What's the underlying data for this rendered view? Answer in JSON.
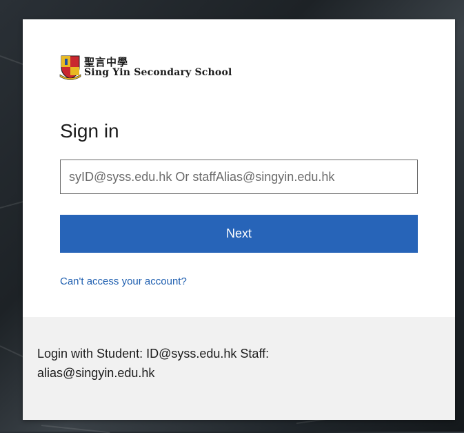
{
  "brand": {
    "name_cn": "聖言中學",
    "name_en": "Sing Yin Secondary School",
    "accent_color": "#2764b8"
  },
  "signin": {
    "title": "Sign in",
    "username_placeholder": "syID@syss.edu.hk Or staffAlias@singyin.edu.hk",
    "username_value": "",
    "next_label": "Next",
    "help_link": "Can't access your account?"
  },
  "footer": {
    "text": "Login with Student: ID@syss.edu.hk Staff: alias@singyin.edu.hk"
  }
}
